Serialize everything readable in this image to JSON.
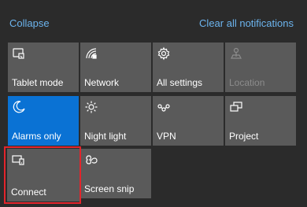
{
  "header": {
    "collapse_label": "Collapse",
    "clear_label": "Clear all notifications"
  },
  "tiles": [
    {
      "label": "Tablet mode",
      "icon": "tablet-mode-icon",
      "state": "normal"
    },
    {
      "label": "Network",
      "icon": "network-icon",
      "state": "normal"
    },
    {
      "label": "All settings",
      "icon": "gear-icon",
      "state": "normal"
    },
    {
      "label": "Location",
      "icon": "location-icon",
      "state": "disabled"
    },
    {
      "label": "Alarms only",
      "icon": "moon-icon",
      "state": "active"
    },
    {
      "label": "Night light",
      "icon": "sun-icon",
      "state": "normal"
    },
    {
      "label": "VPN",
      "icon": "vpn-icon",
      "state": "normal"
    },
    {
      "label": "Project",
      "icon": "project-icon",
      "state": "normal"
    },
    {
      "label": "Connect",
      "icon": "connect-icon",
      "state": "normal"
    },
    {
      "label": "Screen snip",
      "icon": "screen-snip-icon",
      "state": "normal"
    }
  ],
  "colors": {
    "background": "#2b2b2b",
    "tile": "#5a5a5a",
    "active_tile": "#0a72d4",
    "link": "#6cb4ee",
    "highlight_border": "#e3242b"
  }
}
